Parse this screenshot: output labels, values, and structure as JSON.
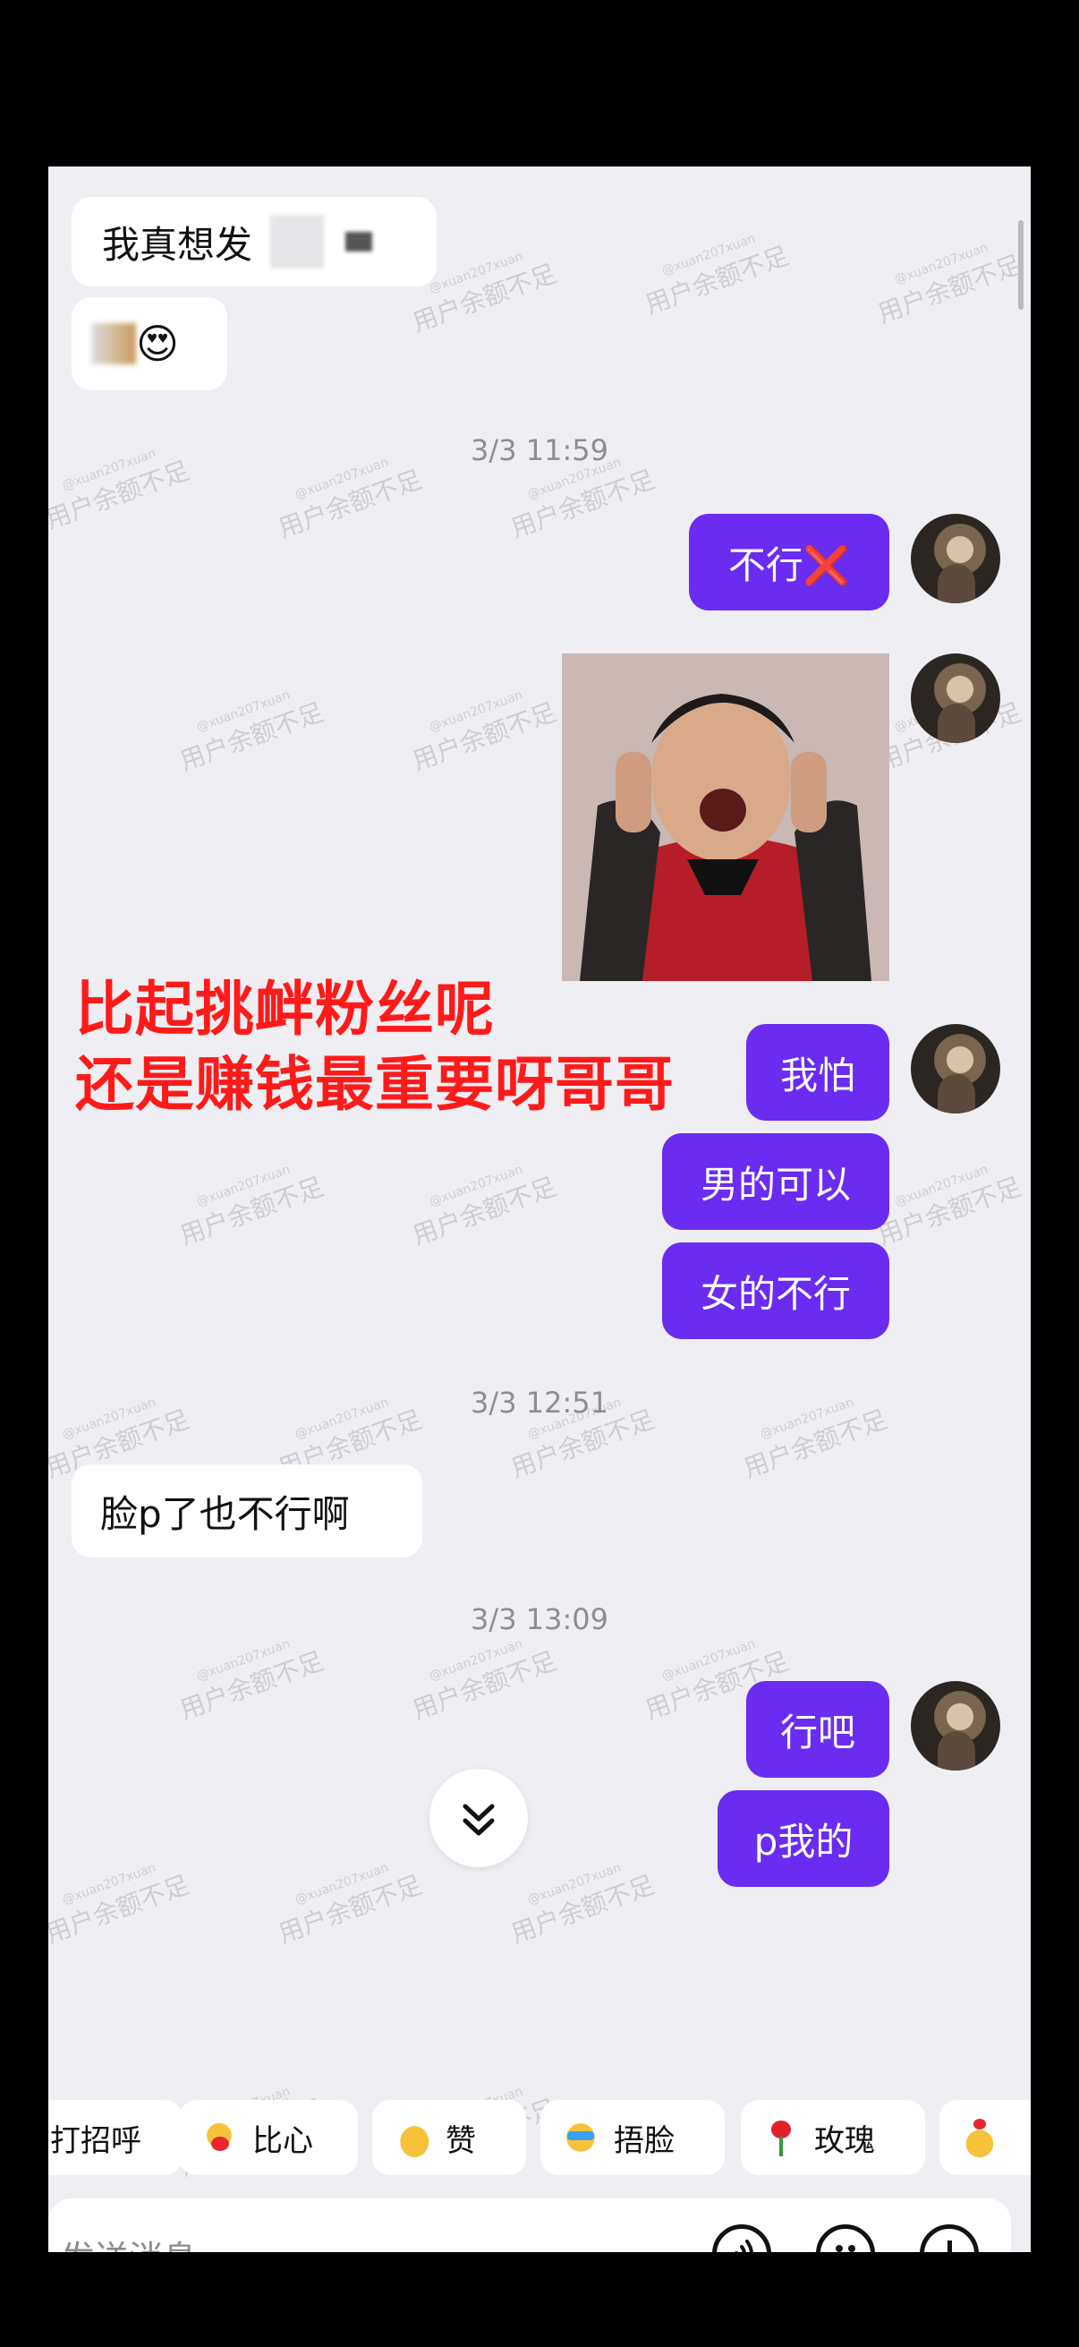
{
  "chat": {
    "messages": [
      {
        "side": "left",
        "text": "我真想发"
      },
      {
        "side": "left",
        "text": "😍"
      },
      {
        "type": "time",
        "text": "3/3 11:59"
      },
      {
        "side": "right",
        "text": "不行❌"
      },
      {
        "side": "right",
        "type": "image"
      },
      {
        "side": "right",
        "text": "我怕"
      },
      {
        "side": "right",
        "text": "男的可以"
      },
      {
        "side": "right",
        "text": "女的不行"
      },
      {
        "type": "time",
        "text": "3/3 12:51"
      },
      {
        "side": "left",
        "text": "脸p了也不行啊"
      },
      {
        "type": "time",
        "text": "3/3 13:09"
      },
      {
        "side": "right",
        "text": "行吧"
      },
      {
        "side": "right",
        "text": "p我的"
      }
    ]
  },
  "caption": {
    "line1": "比起挑衅粉丝呢",
    "line2": "还是赚钱最重要呀哥哥"
  },
  "watermark": {
    "text": "用户余额不足",
    "handle": "@xuan207xuan"
  },
  "quick_replies": [
    {
      "label": "打招呼",
      "icon": "wave-emoji"
    },
    {
      "label": "比心",
      "icon": "heart-hands-emoji"
    },
    {
      "label": "赞",
      "icon": "thumbs-up-emoji"
    },
    {
      "label": "捂脸",
      "icon": "facepalm-emoji"
    },
    {
      "label": "玫瑰",
      "icon": "rose-emoji"
    }
  ],
  "input": {
    "placeholder": "发送消息"
  },
  "colors": {
    "bubble_right": "#6a2cf0",
    "bubble_left": "#ffffff",
    "background": "#efeef3",
    "caption": "#ff1a1a"
  }
}
